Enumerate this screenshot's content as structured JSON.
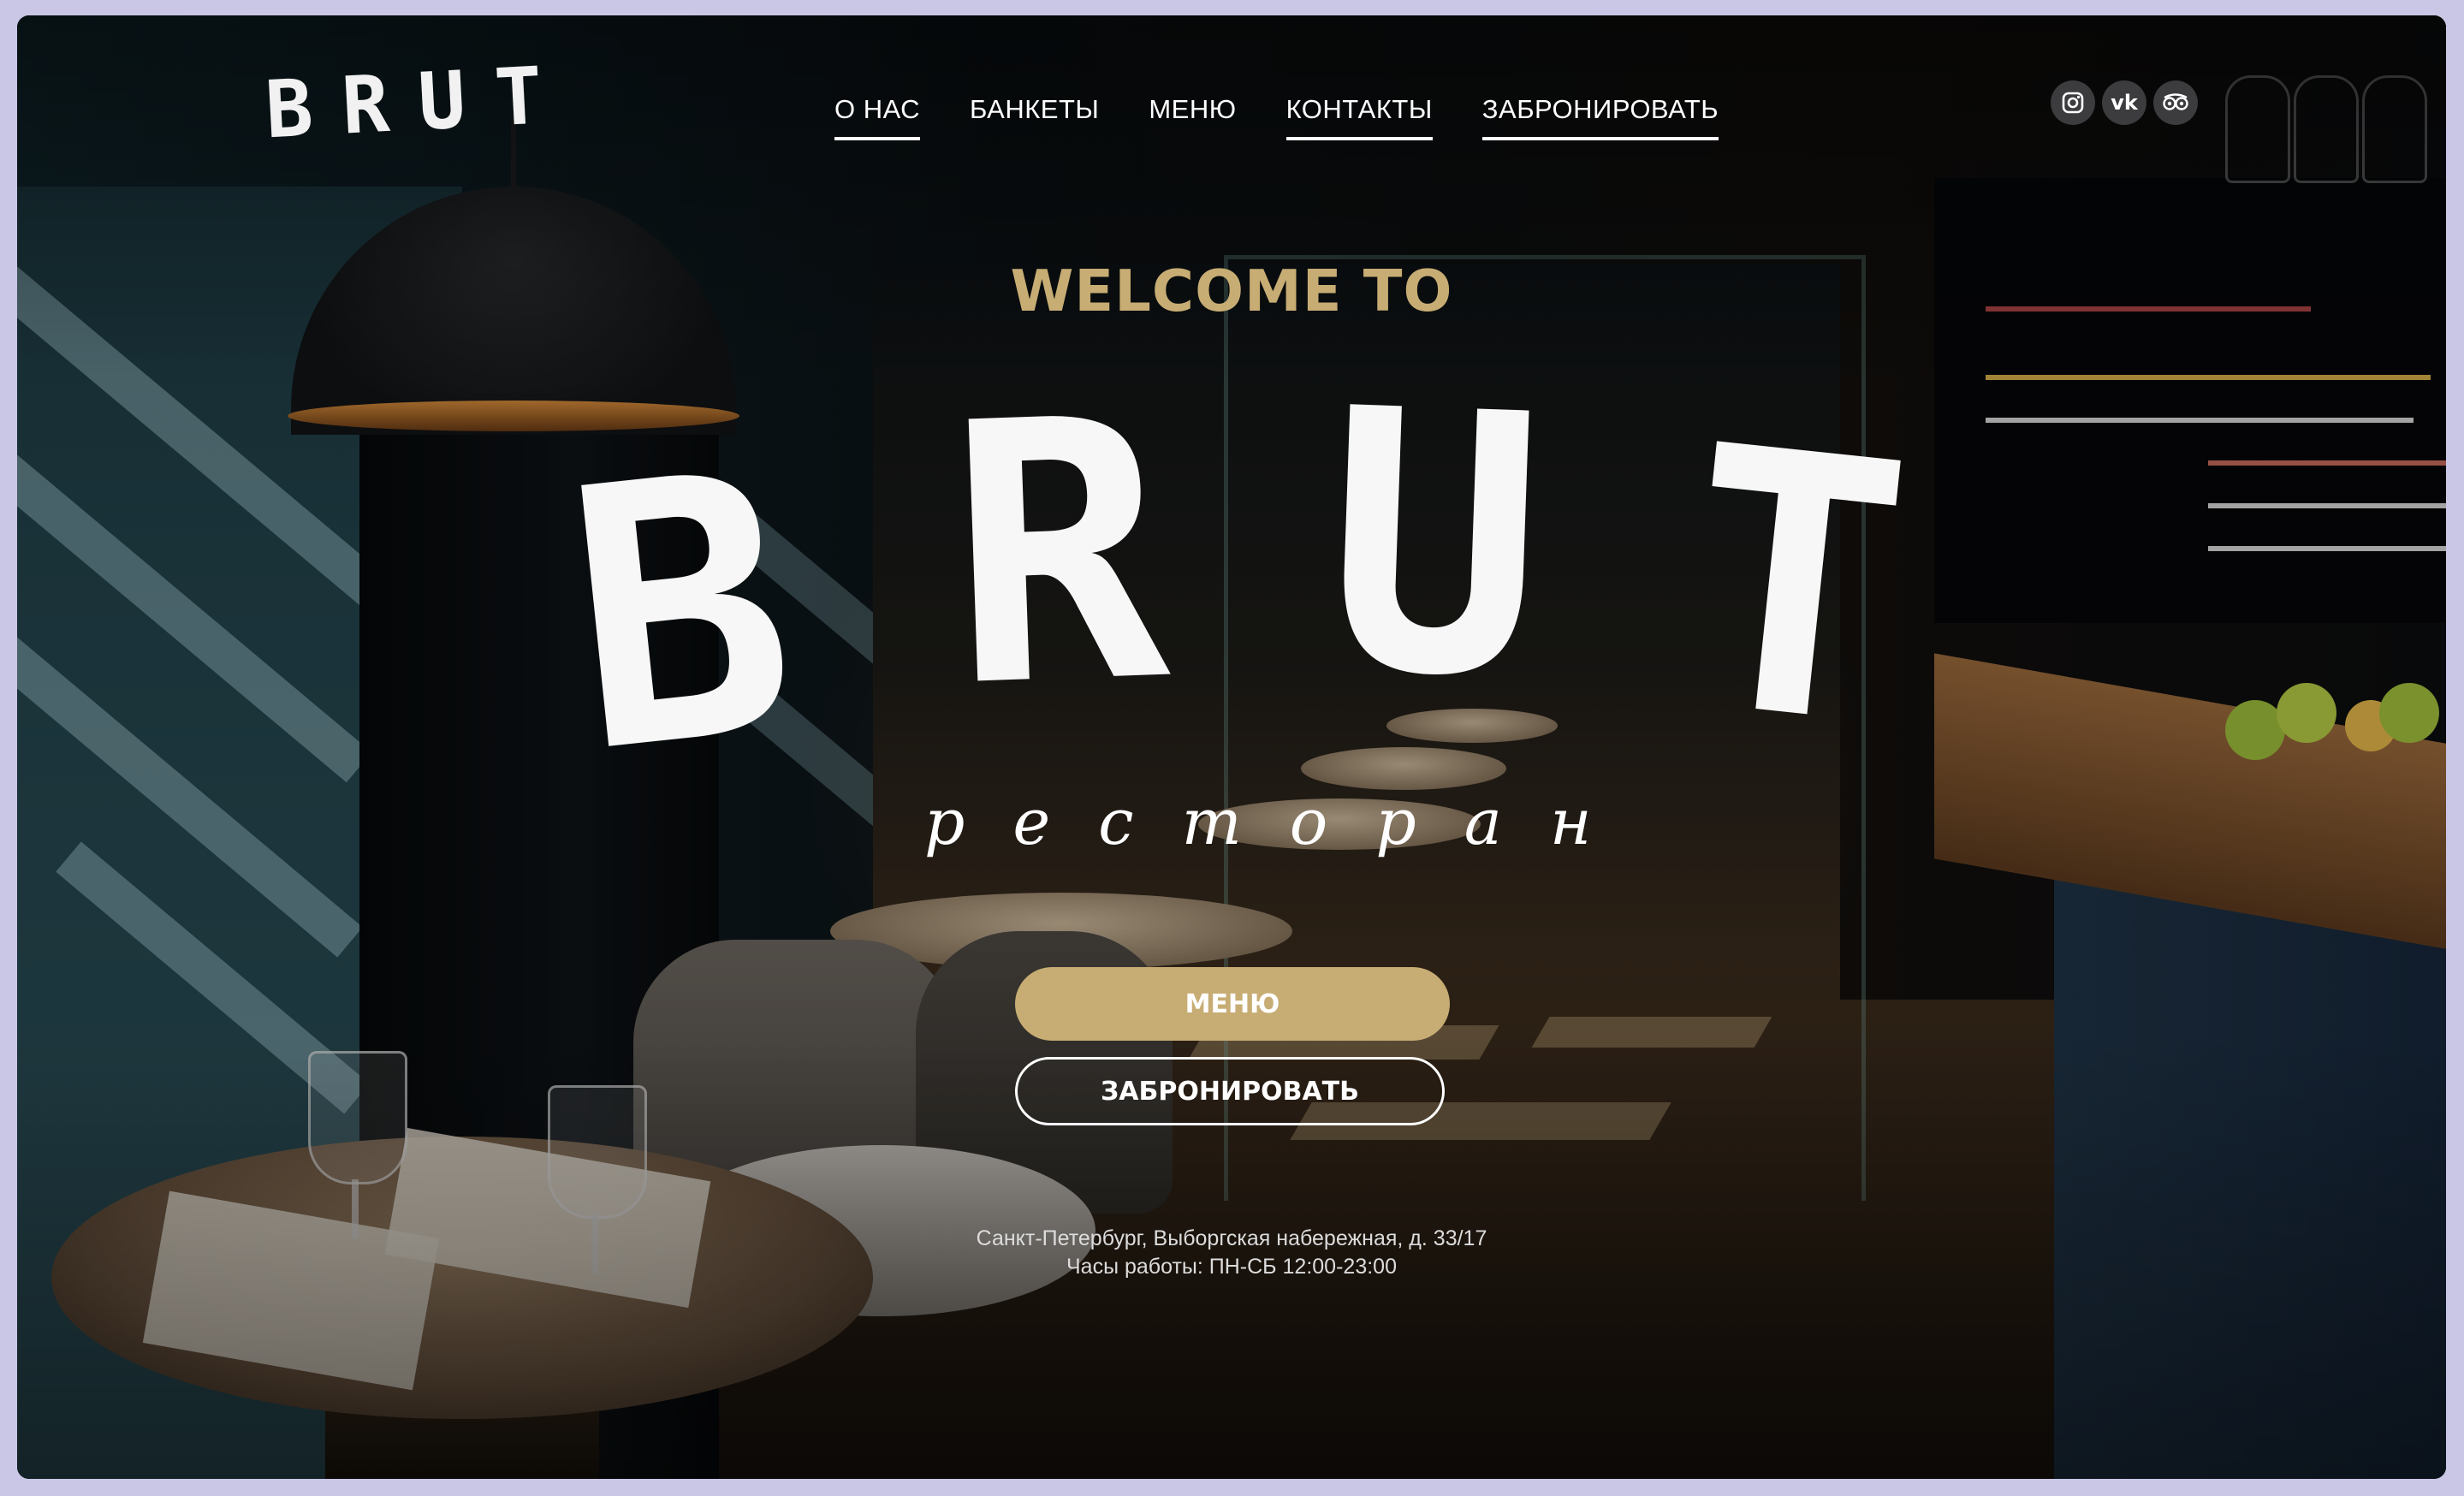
{
  "logo": {
    "text": "BRUT"
  },
  "nav": {
    "items": [
      {
        "label": "О НАС"
      },
      {
        "label": "БАНКЕТЫ"
      },
      {
        "label": "МЕНЮ"
      },
      {
        "label": "КОНТАКТЫ"
      },
      {
        "label": "ЗАБРОНИРОВАТЬ"
      }
    ]
  },
  "social": {
    "instagram": {
      "icon": "instagram-icon"
    },
    "vk": {
      "icon": "vk-icon",
      "glyph": "vk"
    },
    "tripadvisor": {
      "icon": "tripadvisor-icon"
    }
  },
  "hero": {
    "welcome": "WELCOME TO",
    "brand": [
      "B",
      "R",
      "U",
      "T"
    ],
    "subtitle": "ресторан"
  },
  "buttons": {
    "menu": "МЕНЮ",
    "book": "ЗАБРОНИРОВАТЬ"
  },
  "info": {
    "address": "Санкт-Петербург, Выборгская набережная, д. 33/17",
    "hours": "Часы работы: ПН-СБ 12:00-23:00"
  },
  "colors": {
    "accent": "#c7ad74",
    "text": "#ffffff"
  }
}
